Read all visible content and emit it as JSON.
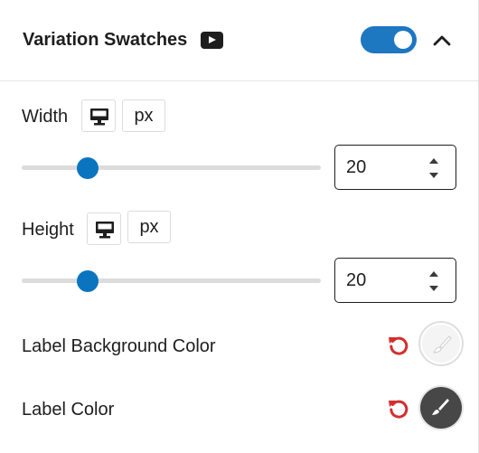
{
  "header": {
    "title": "Variation Swatches",
    "video_icon": "youtube-play-icon",
    "toggle_on": true,
    "collapse_icon": "chevron-up-icon"
  },
  "width_control": {
    "label": "Width",
    "device_icon": "desktop-icon",
    "unit": "px",
    "value": "20",
    "slider_fraction": 0.2
  },
  "height_control": {
    "label": "Height",
    "device_icon": "desktop-icon",
    "unit": "px",
    "value": "20",
    "slider_fraction": 0.2
  },
  "label_background_color": {
    "label": "Label Background Color",
    "reset_icon": "reset-icon",
    "swatch_color": "#f4f4f4"
  },
  "label_color": {
    "label": "Label Color",
    "reset_icon": "reset-icon",
    "swatch_color": "#474747"
  },
  "colors": {
    "accent": "#1d77c1",
    "slider_thumb": "#0a75be",
    "reset": "#d32f2f"
  }
}
